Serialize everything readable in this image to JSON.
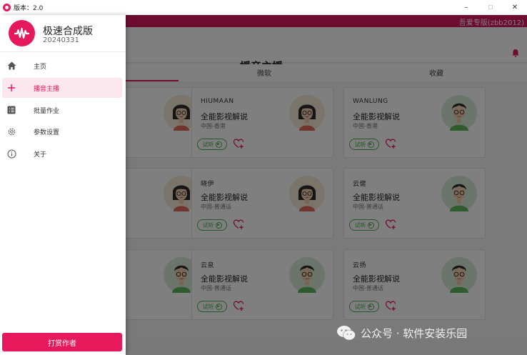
{
  "window": {
    "title": "版本：2.0",
    "minimize": "–",
    "maximize": "☐",
    "close": "✕"
  },
  "header": {
    "account_label": "吾爱专版(zbb2012)",
    "page_title": "播音主播"
  },
  "tabs": [
    {
      "label": "微软"
    },
    {
      "label": "收藏"
    }
  ],
  "cards": [
    {
      "name": "",
      "desc": "",
      "loc": "",
      "avatar": "female"
    },
    {
      "name": "HIUMAAN",
      "desc": "全能影视解说",
      "loc": "中国-香港",
      "listen": "试听",
      "avatar": "female"
    },
    {
      "name": "WANLUNG",
      "desc": "全能影视解说",
      "loc": "中国-香港",
      "listen": "试听",
      "avatar": "male"
    },
    {
      "name": "",
      "desc": "",
      "loc": "",
      "avatar": "female"
    },
    {
      "name": "晓伊",
      "desc": "全能影视解说",
      "loc": "中国-普通话",
      "listen": "试听",
      "avatar": "female"
    },
    {
      "name": "云健",
      "desc": "全能影视解说",
      "loc": "中国-普通话",
      "listen": "试听",
      "avatar": "male"
    },
    {
      "name": "",
      "desc": "",
      "loc": "",
      "avatar": "male"
    },
    {
      "name": "云泉",
      "desc": "全能影视解说",
      "loc": "中国-普通话",
      "listen": "试听",
      "avatar": "male"
    },
    {
      "name": "云扬",
      "desc": "全能影视解说",
      "loc": "中国-普通话",
      "listen": "试听",
      "avatar": "male"
    }
  ],
  "drawer": {
    "app_name": "极速合成版",
    "app_version": "20240331",
    "items": [
      {
        "label": "主页",
        "icon": "home-icon"
      },
      {
        "label": "播音主播",
        "icon": "plus-icon"
      },
      {
        "label": "批量作业",
        "icon": "list-icon"
      },
      {
        "label": "参数设置",
        "icon": "gear-icon"
      },
      {
        "label": "关于",
        "icon": "info-icon"
      }
    ],
    "reward_label": "打赏作者"
  },
  "watermark": "公众号 · 软件安装乐园",
  "colors": {
    "accent": "#e5195c",
    "green": "#4caf50"
  }
}
